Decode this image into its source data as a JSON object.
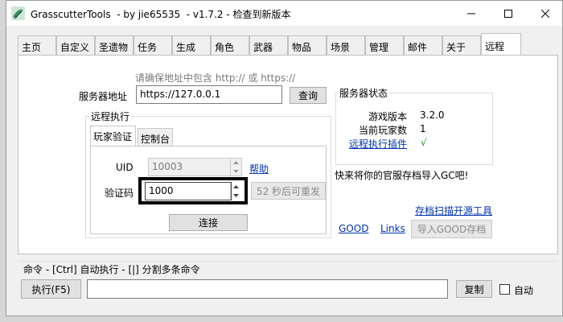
{
  "window": {
    "title": "GrasscutterTools  - by jie65535  - v1.7.2 - 检查到新版本"
  },
  "tabs": [
    "主页",
    "自定义",
    "圣遗物",
    "任务",
    "生成",
    "角色",
    "武器",
    "物品",
    "场景",
    "管理",
    "邮件",
    "关于",
    "远程"
  ],
  "active_tab": "远程",
  "server": {
    "hint": "请确保地址中包含 http:// 或 https://",
    "address_label": "服务器地址",
    "address_value": "https://127.0.0.1",
    "query_button": "查询"
  },
  "server_status": {
    "title": "服务器状态",
    "game_version_label": "游戏版本",
    "game_version_value": "3.2.0",
    "players_label": "当前玩家数",
    "players_value": "1",
    "plugin_label": "远程执行插件",
    "plugin_value": "√"
  },
  "remote_exec": {
    "title": "远程执行",
    "inner_tabs": [
      "玩家验证",
      "控制台"
    ],
    "active_inner_tab": "玩家验证",
    "uid_label": "UID",
    "uid_value": "10003",
    "help_link": "帮助",
    "code_label": "验证码",
    "code_value": "1000",
    "resend_button": "52 秒后可重发",
    "connect_button": "连接"
  },
  "import_hint": "快来将你的官服存档导入GC吧!",
  "links": {
    "scanner": "存档扫描开源工具",
    "good": "GOOD",
    "links": "Links",
    "import_good": "导入GOOD存档"
  },
  "command": {
    "label": "命令  - [Ctrl] 自动执行  - [|] 分割多条命令",
    "execute_button": "执行(F5)",
    "input_value": "",
    "copy_button": "复制",
    "auto_label": "自动"
  }
}
